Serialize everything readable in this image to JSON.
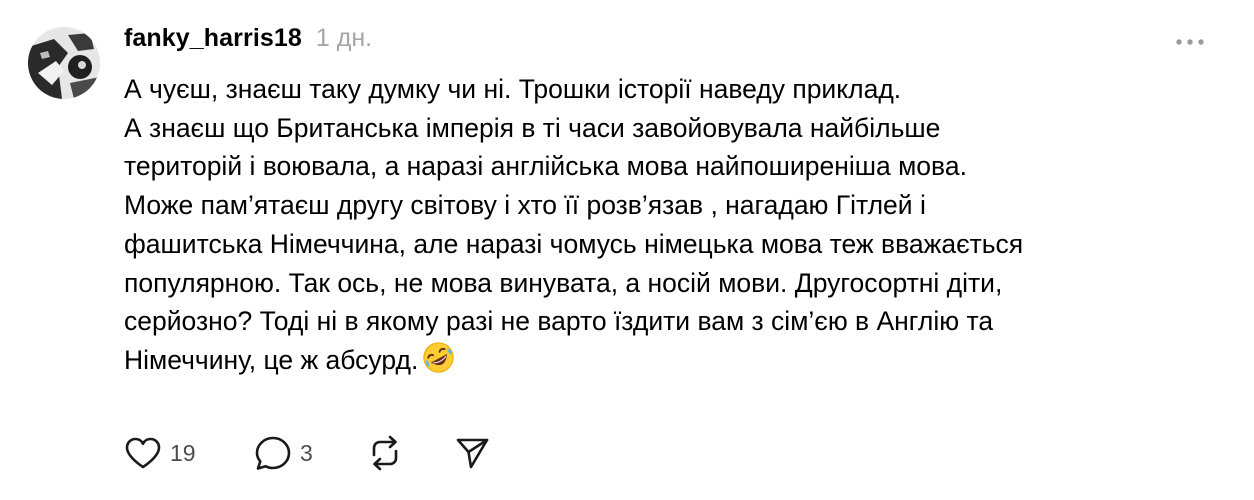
{
  "post": {
    "username": "fanky_harris18",
    "timestamp": "1 дн.",
    "lines": [
      "А чуєш, знаєш таку думку чи ні. Трошки історії наведу приклад.",
      "А знаєш що Британська імперія в ті часи завойовувала найбільше",
      "територій і воювала, а наразі англійська мова найпоширеніша мова.",
      "Може пам’ятаєш другу світову і хто її розв’язав , нагадаю Гітлей і",
      "фашитська Німеччина, але наразі чомусь німецька мова теж вважається",
      "популярною. Так ось, не мова винувата, а носій мови. Другосортні діти,",
      "серйозно? Тоді ні в якому разі не варто їздити вам з сім’єю в Англію та",
      "Німеччину, це ж абсурд."
    ],
    "emoji": "rolling-on-floor-laughing-emoji"
  },
  "actions": {
    "likes": "19",
    "replies": "3"
  },
  "icons": {
    "more": "more-horizontal-icon",
    "like": "heart-icon",
    "reply": "speech-bubble-icon",
    "repost": "repost-icon",
    "share": "send-icon"
  },
  "colors": {
    "text": "#000000",
    "muted": "#a6a6a6",
    "icon": "#1a1a1a",
    "count": "#4d4d4d"
  }
}
